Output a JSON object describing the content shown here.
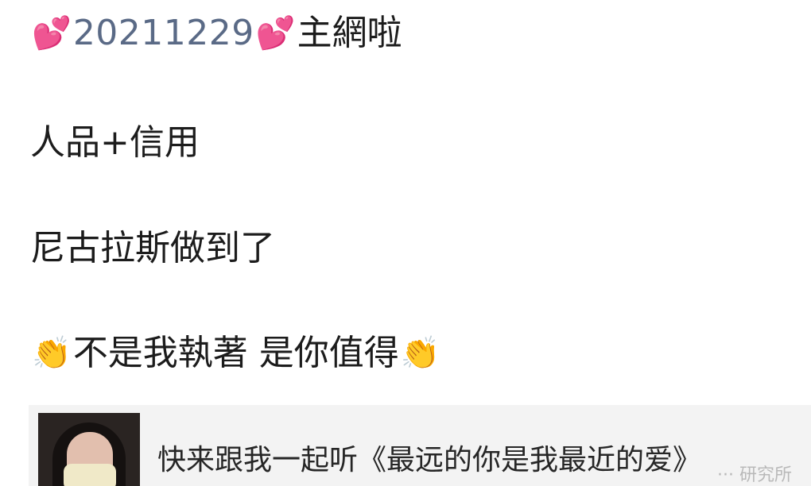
{
  "post": {
    "line1": {
      "emoji_left": "💕",
      "date": "20211229",
      "emoji_right": "💕",
      "text": "主網啦"
    },
    "line2": "人品+信用",
    "line3": "尼古拉斯做到了",
    "line4": {
      "emoji_left": "👏",
      "text": "不是我執著 是你值得",
      "emoji_right": "👏"
    }
  },
  "share_card": {
    "cover_icon": "singer-photo",
    "title": "快来跟我一起听《最远的你是我最近的爱》"
  },
  "watermark": "··· 研究所"
}
